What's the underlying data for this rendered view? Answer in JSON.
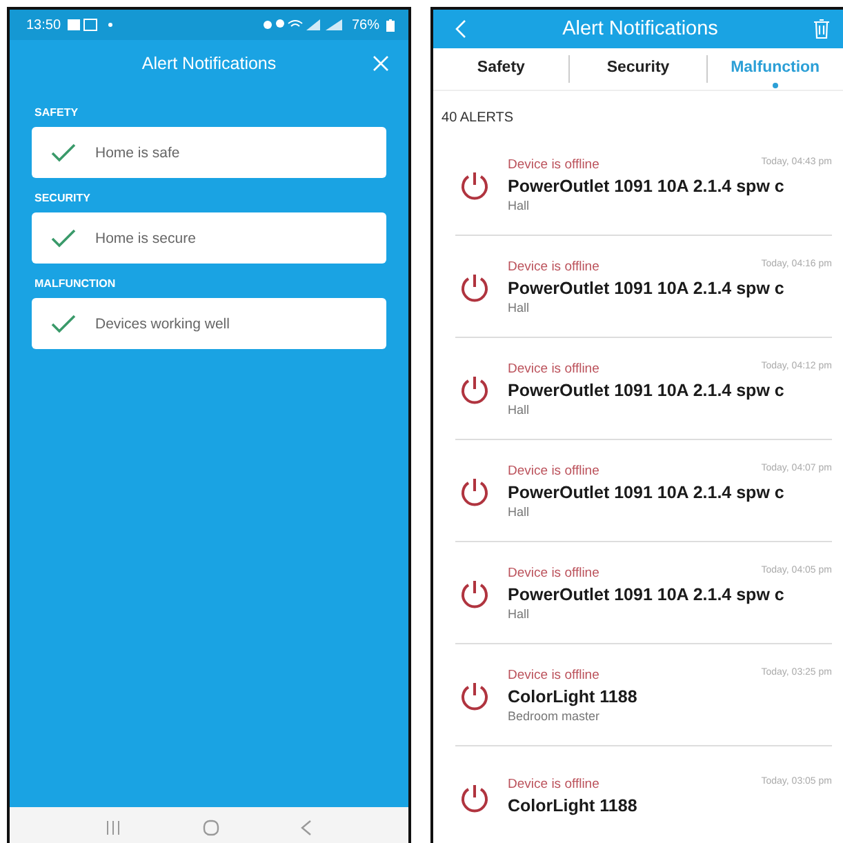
{
  "left_screen": {
    "status_bar": {
      "time": "13:50",
      "battery": "76%"
    },
    "header": {
      "title": "Alert Notifications"
    },
    "sections": [
      {
        "heading": "SAFETY",
        "message": "Home is safe"
      },
      {
        "heading": "SECURITY",
        "message": "Home is secure"
      },
      {
        "heading": "MALFUNCTION",
        "message": "Devices working well"
      }
    ]
  },
  "right_screen": {
    "header": {
      "title": "Alert Notifications"
    },
    "tabs": [
      {
        "label": "Safety",
        "selected": false
      },
      {
        "label": "Security",
        "selected": false
      },
      {
        "label": "Malfunction",
        "selected": true
      }
    ],
    "alert_count": "40 ALERTS",
    "alerts": [
      {
        "status": "Device is offline",
        "time": "Today, 04:43 pm",
        "device": "PowerOutlet 1091 10A 2.1.4 spw c",
        "room": "Hall"
      },
      {
        "status": "Device is offline",
        "time": "Today, 04:16 pm",
        "device": "PowerOutlet 1091 10A 2.1.4 spw c",
        "room": "Hall"
      },
      {
        "status": "Device is offline",
        "time": "Today, 04:12 pm",
        "device": "PowerOutlet 1091 10A 2.1.4 spw c",
        "room": "Hall"
      },
      {
        "status": "Device is offline",
        "time": "Today, 04:07 pm",
        "device": "PowerOutlet 1091 10A 2.1.4 spw c",
        "room": "Hall"
      },
      {
        "status": "Device is offline",
        "time": "Today, 04:05 pm",
        "device": "PowerOutlet 1091 10A 2.1.4 spw c",
        "room": "Hall"
      },
      {
        "status": "Device is offline",
        "time": "Today, 03:25 pm",
        "device": "ColorLight 1188",
        "room": "Bedroom master"
      },
      {
        "status": "Device is offline",
        "time": "Today, 03:05 pm",
        "device": "ColorLight 1188"
      }
    ]
  }
}
